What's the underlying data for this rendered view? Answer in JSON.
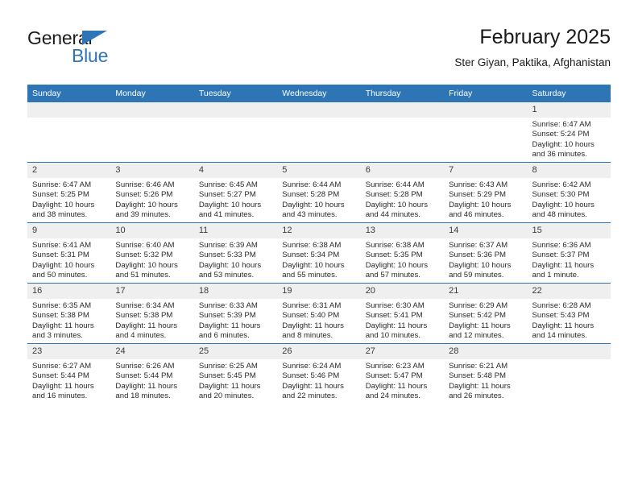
{
  "brand": {
    "name_part1": "General",
    "name_part2": "Blue",
    "accent_color": "#2e75b6"
  },
  "header": {
    "title": "February 2025",
    "subtitle": "Ster Giyan, Paktika, Afghanistan"
  },
  "calendar": {
    "weekday_headers": [
      "Sunday",
      "Monday",
      "Tuesday",
      "Wednesday",
      "Thursday",
      "Friday",
      "Saturday"
    ],
    "header_bg": "#2e75b6",
    "daynum_bg": "#efefef",
    "weeks": [
      [
        {
          "empty": true
        },
        {
          "empty": true
        },
        {
          "empty": true
        },
        {
          "empty": true
        },
        {
          "empty": true
        },
        {
          "empty": true
        },
        {
          "day": "1",
          "sunrise": "Sunrise: 6:47 AM",
          "sunset": "Sunset: 5:24 PM",
          "daylight": "Daylight: 10 hours and 36 minutes."
        }
      ],
      [
        {
          "day": "2",
          "sunrise": "Sunrise: 6:47 AM",
          "sunset": "Sunset: 5:25 PM",
          "daylight": "Daylight: 10 hours and 38 minutes."
        },
        {
          "day": "3",
          "sunrise": "Sunrise: 6:46 AM",
          "sunset": "Sunset: 5:26 PM",
          "daylight": "Daylight: 10 hours and 39 minutes."
        },
        {
          "day": "4",
          "sunrise": "Sunrise: 6:45 AM",
          "sunset": "Sunset: 5:27 PM",
          "daylight": "Daylight: 10 hours and 41 minutes."
        },
        {
          "day": "5",
          "sunrise": "Sunrise: 6:44 AM",
          "sunset": "Sunset: 5:28 PM",
          "daylight": "Daylight: 10 hours and 43 minutes."
        },
        {
          "day": "6",
          "sunrise": "Sunrise: 6:44 AM",
          "sunset": "Sunset: 5:28 PM",
          "daylight": "Daylight: 10 hours and 44 minutes."
        },
        {
          "day": "7",
          "sunrise": "Sunrise: 6:43 AM",
          "sunset": "Sunset: 5:29 PM",
          "daylight": "Daylight: 10 hours and 46 minutes."
        },
        {
          "day": "8",
          "sunrise": "Sunrise: 6:42 AM",
          "sunset": "Sunset: 5:30 PM",
          "daylight": "Daylight: 10 hours and 48 minutes."
        }
      ],
      [
        {
          "day": "9",
          "sunrise": "Sunrise: 6:41 AM",
          "sunset": "Sunset: 5:31 PM",
          "daylight": "Daylight: 10 hours and 50 minutes."
        },
        {
          "day": "10",
          "sunrise": "Sunrise: 6:40 AM",
          "sunset": "Sunset: 5:32 PM",
          "daylight": "Daylight: 10 hours and 51 minutes."
        },
        {
          "day": "11",
          "sunrise": "Sunrise: 6:39 AM",
          "sunset": "Sunset: 5:33 PM",
          "daylight": "Daylight: 10 hours and 53 minutes."
        },
        {
          "day": "12",
          "sunrise": "Sunrise: 6:38 AM",
          "sunset": "Sunset: 5:34 PM",
          "daylight": "Daylight: 10 hours and 55 minutes."
        },
        {
          "day": "13",
          "sunrise": "Sunrise: 6:38 AM",
          "sunset": "Sunset: 5:35 PM",
          "daylight": "Daylight: 10 hours and 57 minutes."
        },
        {
          "day": "14",
          "sunrise": "Sunrise: 6:37 AM",
          "sunset": "Sunset: 5:36 PM",
          "daylight": "Daylight: 10 hours and 59 minutes."
        },
        {
          "day": "15",
          "sunrise": "Sunrise: 6:36 AM",
          "sunset": "Sunset: 5:37 PM",
          "daylight": "Daylight: 11 hours and 1 minute."
        }
      ],
      [
        {
          "day": "16",
          "sunrise": "Sunrise: 6:35 AM",
          "sunset": "Sunset: 5:38 PM",
          "daylight": "Daylight: 11 hours and 3 minutes."
        },
        {
          "day": "17",
          "sunrise": "Sunrise: 6:34 AM",
          "sunset": "Sunset: 5:38 PM",
          "daylight": "Daylight: 11 hours and 4 minutes."
        },
        {
          "day": "18",
          "sunrise": "Sunrise: 6:33 AM",
          "sunset": "Sunset: 5:39 PM",
          "daylight": "Daylight: 11 hours and 6 minutes."
        },
        {
          "day": "19",
          "sunrise": "Sunrise: 6:31 AM",
          "sunset": "Sunset: 5:40 PM",
          "daylight": "Daylight: 11 hours and 8 minutes."
        },
        {
          "day": "20",
          "sunrise": "Sunrise: 6:30 AM",
          "sunset": "Sunset: 5:41 PM",
          "daylight": "Daylight: 11 hours and 10 minutes."
        },
        {
          "day": "21",
          "sunrise": "Sunrise: 6:29 AM",
          "sunset": "Sunset: 5:42 PM",
          "daylight": "Daylight: 11 hours and 12 minutes."
        },
        {
          "day": "22",
          "sunrise": "Sunrise: 6:28 AM",
          "sunset": "Sunset: 5:43 PM",
          "daylight": "Daylight: 11 hours and 14 minutes."
        }
      ],
      [
        {
          "day": "23",
          "sunrise": "Sunrise: 6:27 AM",
          "sunset": "Sunset: 5:44 PM",
          "daylight": "Daylight: 11 hours and 16 minutes."
        },
        {
          "day": "24",
          "sunrise": "Sunrise: 6:26 AM",
          "sunset": "Sunset: 5:44 PM",
          "daylight": "Daylight: 11 hours and 18 minutes."
        },
        {
          "day": "25",
          "sunrise": "Sunrise: 6:25 AM",
          "sunset": "Sunset: 5:45 PM",
          "daylight": "Daylight: 11 hours and 20 minutes."
        },
        {
          "day": "26",
          "sunrise": "Sunrise: 6:24 AM",
          "sunset": "Sunset: 5:46 PM",
          "daylight": "Daylight: 11 hours and 22 minutes."
        },
        {
          "day": "27",
          "sunrise": "Sunrise: 6:23 AM",
          "sunset": "Sunset: 5:47 PM",
          "daylight": "Daylight: 11 hours and 24 minutes."
        },
        {
          "day": "28",
          "sunrise": "Sunrise: 6:21 AM",
          "sunset": "Sunset: 5:48 PM",
          "daylight": "Daylight: 11 hours and 26 minutes."
        },
        {
          "empty": true
        }
      ]
    ]
  }
}
